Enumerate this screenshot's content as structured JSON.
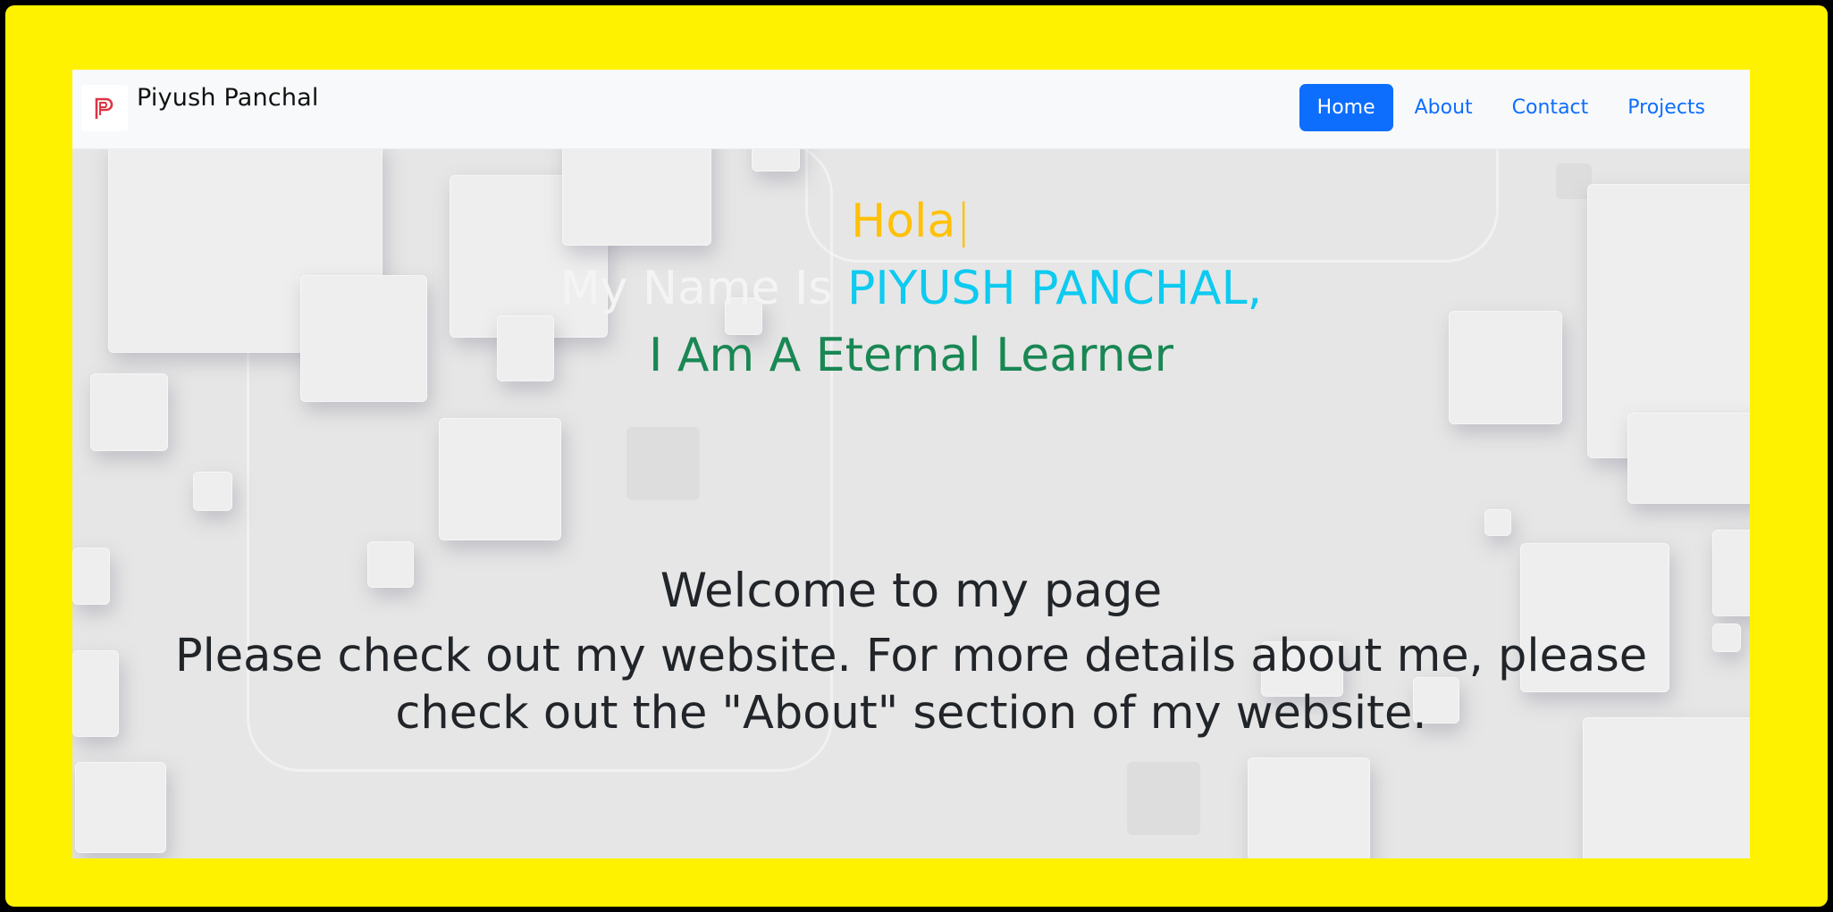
{
  "navbar": {
    "brand_name": "Piyush Panchal",
    "logo_icon": "pp-monogram-logo",
    "links": [
      "Home",
      "About",
      "Contact",
      "Projects"
    ],
    "active_link": "Home"
  },
  "hero": {
    "greeting": "Hola",
    "caret": "|",
    "name_prefix": "My Name Is ",
    "name": "PIYUSH PANCHAL,",
    "tagline": "I Am A Eternal Learner",
    "welcome": "Welcome to my page",
    "details": "Please check out my website. For more details about me, please check out the \"About\" section of my website."
  },
  "colors": {
    "frame": "#fff200",
    "primary": "#0d6efd",
    "greeting": "#ffc107",
    "name": "#0dcaf0",
    "tagline": "#198754",
    "text": "#212529"
  }
}
